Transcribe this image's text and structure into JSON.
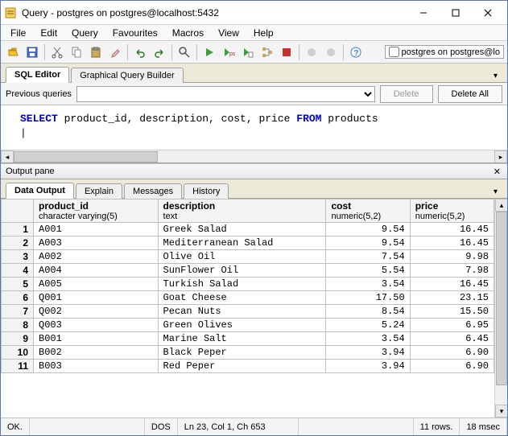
{
  "title": "Query - postgres on postgres@localhost:5432",
  "menus": [
    "File",
    "Edit",
    "Query",
    "Favourites",
    "Macros",
    "View",
    "Help"
  ],
  "connection_label": "postgres on postgres@lo",
  "editor_tabs": {
    "sql": "SQL Editor",
    "gqb": "Graphical Query Builder"
  },
  "prev_queries": {
    "label": "Previous queries",
    "delete": "Delete",
    "delete_all": "Delete All"
  },
  "sql": {
    "kw1": "SELECT",
    "body": " product_id, description, cost, price ",
    "kw2": "FROM",
    "tail": " products"
  },
  "output_pane_title": "Output pane",
  "output_tabs": {
    "data": "Data Output",
    "explain": "Explain",
    "messages": "Messages",
    "history": "History"
  },
  "chart_data": {
    "type": "table",
    "columns": [
      {
        "name": "product_id",
        "type": "character varying(5)"
      },
      {
        "name": "description",
        "type": "text"
      },
      {
        "name": "cost",
        "type": "numeric(5,2)"
      },
      {
        "name": "price",
        "type": "numeric(5,2)"
      }
    ],
    "rows": [
      {
        "n": "1",
        "product_id": "A001",
        "description": "Greek Salad",
        "cost": "9.54",
        "price": "16.45"
      },
      {
        "n": "2",
        "product_id": "A003",
        "description": "Mediterranean Salad",
        "cost": "9.54",
        "price": "16.45"
      },
      {
        "n": "3",
        "product_id": "A002",
        "description": "Olive Oil",
        "cost": "7.54",
        "price": "9.98"
      },
      {
        "n": "4",
        "product_id": "A004",
        "description": "SunFlower Oil",
        "cost": "5.54",
        "price": "7.98"
      },
      {
        "n": "5",
        "product_id": "A005",
        "description": "Turkish Salad",
        "cost": "3.54",
        "price": "16.45"
      },
      {
        "n": "6",
        "product_id": "Q001",
        "description": "Goat Cheese",
        "cost": "17.50",
        "price": "23.15"
      },
      {
        "n": "7",
        "product_id": "Q002",
        "description": "Pecan Nuts",
        "cost": "8.54",
        "price": "15.50"
      },
      {
        "n": "8",
        "product_id": "Q003",
        "description": "Green Olives",
        "cost": "5.24",
        "price": "6.95"
      },
      {
        "n": "9",
        "product_id": "B001",
        "description": "Marine Salt",
        "cost": "3.54",
        "price": "6.45"
      },
      {
        "n": "10",
        "product_id": "B002",
        "description": "Black Peper",
        "cost": "3.94",
        "price": "6.90"
      },
      {
        "n": "11",
        "product_id": "B003",
        "description": "Red Peper",
        "cost": "3.94",
        "price": "6.90"
      }
    ]
  },
  "status": {
    "ok": "OK.",
    "mode": "DOS",
    "pos": "Ln 23, Col 1, Ch 653",
    "rows": "11 rows.",
    "time": "18 msec"
  }
}
